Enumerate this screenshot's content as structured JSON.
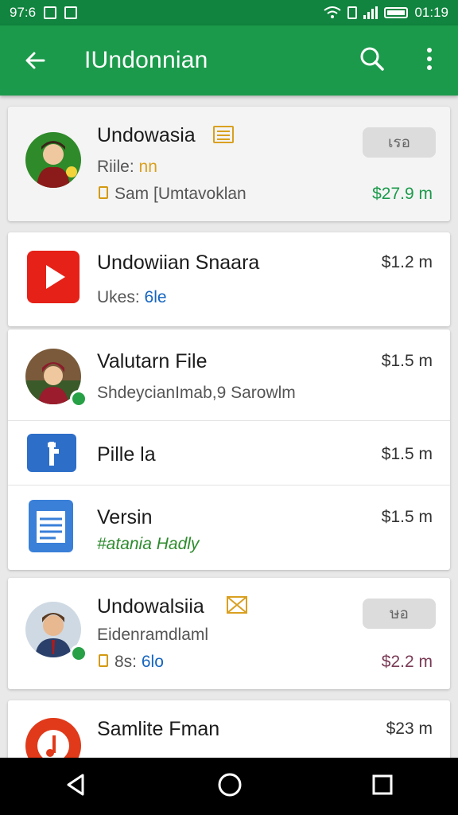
{
  "status_bar": {
    "time_left": "97:6",
    "time_right": "01:19"
  },
  "app_bar": {
    "title": "IUndonnian",
    "back_icon": "back-arrow-icon",
    "search_icon": "search-icon",
    "more_icon": "more-vert-icon"
  },
  "items": [
    {
      "name": "Undowasia",
      "sub_prefix": "Riile:",
      "sub_value": "nn",
      "detail": "Sam [Umtavoklan",
      "price": "$27.9 m",
      "pill": "เรอ"
    },
    {
      "name": "Undowiian Snaara",
      "sub_prefix": "Ukes:",
      "sub_value": "6le",
      "price": "$1.2 m"
    },
    {
      "name": "Valutarn File",
      "sub": "ShdeycianImab,9 Sarowlm",
      "price": "$1.5 m"
    },
    {
      "name": "Pille la",
      "price": "$1.5 m"
    },
    {
      "name": "Versin",
      "sub": "#atania Hadly",
      "price": "$1.5 m"
    },
    {
      "name": "Undowalsiia",
      "sub": "Eidenramdlaml",
      "detail_prefix": "8s:",
      "detail_value": "6lo",
      "price": "$2.2 m",
      "pill": "ษอ"
    },
    {
      "name": "Samlite Fman",
      "price": "$23 m"
    }
  ],
  "colors": {
    "primary": "#1b9a4b",
    "status": "#11843f",
    "accent_gold": "#d9a020",
    "link_blue": "#1565c0"
  }
}
